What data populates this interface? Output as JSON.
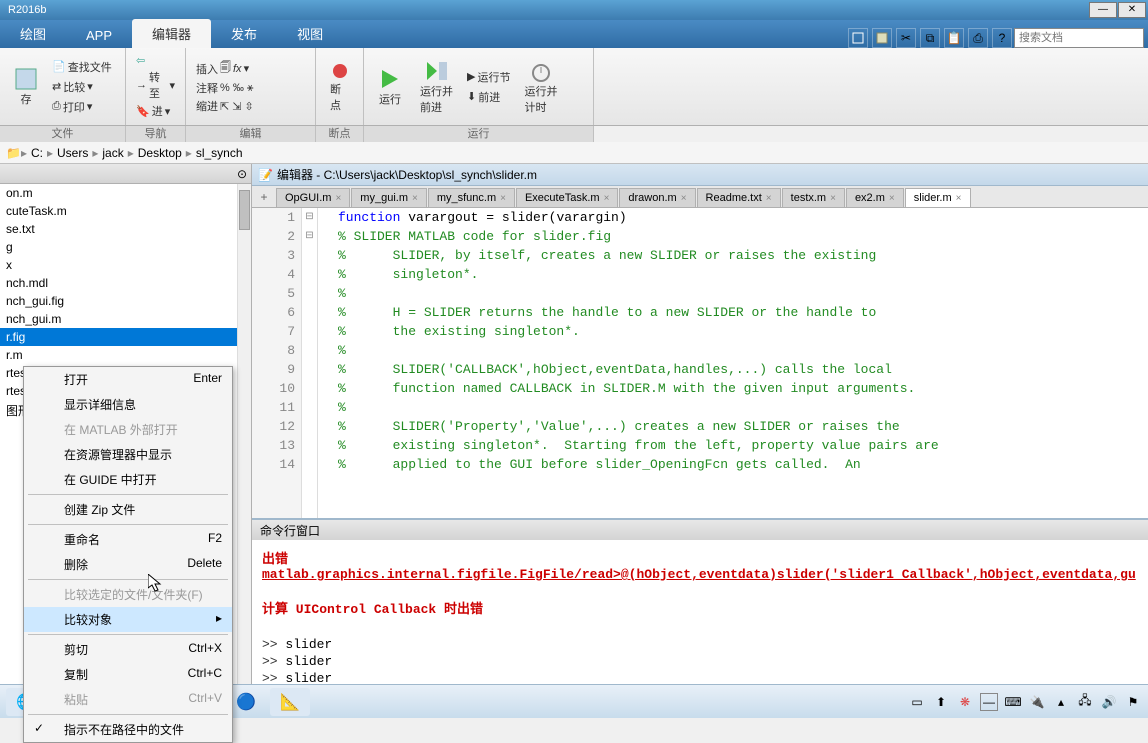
{
  "title": "R2016b",
  "main_tabs": [
    "绘图",
    "APP",
    "编辑器",
    "发布",
    "视图"
  ],
  "main_tab_active": 2,
  "search_placeholder": "搜索文档",
  "ribbon": {
    "file": {
      "save": "存",
      "findfiles": "查找文件",
      "compare": "比较",
      "print": "打印"
    },
    "nav": {
      "back": "",
      "fwd": "",
      "goto": "转至",
      "bookmark": "进"
    },
    "edit": {
      "insert": "插入",
      "comment": "注释",
      "indent": "缩进",
      "fx": "fx"
    },
    "break": {
      "breakpoint": "断点"
    },
    "run": {
      "run": "运行",
      "runsection": "运行并\n前进",
      "runadvance": "运行节",
      "advance": "前进",
      "runtime": "运行并\n计时"
    },
    "labels": [
      "文件",
      "导航",
      "编辑",
      "断点",
      "运行"
    ]
  },
  "address": [
    "C:",
    "Users",
    "jack",
    "Desktop",
    "sl_synch"
  ],
  "files": [
    "on.m",
    "cuteTask.m",
    "se.txt",
    "g",
    "x",
    "nch.mdl",
    "nch_gui.fig",
    "nch_gui.m",
    "r.fig",
    "r.m",
    "rtes",
    "rtes",
    "图形"
  ],
  "file_selected": 8,
  "context": {
    "open": "打开",
    "open_key": "Enter",
    "show_detail": "显示详细信息",
    "open_outside": "在 MATLAB 外部打开",
    "show_explorer": "在资源管理器中显示",
    "open_guide": "在 GUIDE 中打开",
    "create_zip": "创建 Zip 文件",
    "rename": "重命名",
    "rename_key": "F2",
    "delete": "删除",
    "delete_key": "Delete",
    "compare_selected": "比较选定的文件/文件夹(F)",
    "compare_with": "比较对象",
    "cut": "剪切",
    "cut_key": "Ctrl+X",
    "copy": "复制",
    "copy_key": "Ctrl+C",
    "paste": "粘贴",
    "paste_key": "Ctrl+V",
    "indicate": "指示不在路径中的文件"
  },
  "editor": {
    "title": "编辑器 - C:\\Users\\jack\\Desktop\\sl_synch\\slider.m",
    "tabs": [
      "OpGUI.m",
      "my_gui.m",
      "my_sfunc.m",
      "ExecuteTask.m",
      "drawon.m",
      "Readme.txt",
      "testx.m",
      "ex2.m",
      "slider.m"
    ],
    "tab_active": 8,
    "lines": [
      {
        "n": 1,
        "kw": "function",
        "rest": " varargout = slider(varargin)"
      },
      {
        "n": 2,
        "cm": "% SLIDER MATLAB code for slider.fig"
      },
      {
        "n": 3,
        "cm": "%      SLIDER, by itself, creates a new SLIDER or raises the existing"
      },
      {
        "n": 4,
        "cm": "%      singleton*."
      },
      {
        "n": 5,
        "cm": "%"
      },
      {
        "n": 6,
        "cm": "%      H = SLIDER returns the handle to a new SLIDER or the handle to"
      },
      {
        "n": 7,
        "cm": "%      the existing singleton*."
      },
      {
        "n": 8,
        "cm": "%"
      },
      {
        "n": 9,
        "cm": "%      SLIDER('CALLBACK',hObject,eventData,handles,...) calls the local"
      },
      {
        "n": 10,
        "cm": "%      function named CALLBACK in SLIDER.M with the given input arguments."
      },
      {
        "n": 11,
        "cm": "%"
      },
      {
        "n": 12,
        "cm": "%      SLIDER('Property','Value',...) creates a new SLIDER or raises the"
      },
      {
        "n": 13,
        "cm": "%      existing singleton*.  Starting from the left, property value pairs are"
      },
      {
        "n": 14,
        "cm": "%      applied to the GUI before slider_OpeningFcn gets called.  An"
      }
    ]
  },
  "cmd": {
    "title": "命令行窗口",
    "error_prefix": "出错",
    "error_link": "matlab.graphics.internal.figfile.FigFile/read>@(hObject,eventdata)slider('slider1_Callback',hObject,eventdata,gu",
    "err2": "计算 UIControl Callback 时出错",
    "history": [
      "slider",
      "slider",
      "slider"
    ],
    "prompt": ">>"
  }
}
